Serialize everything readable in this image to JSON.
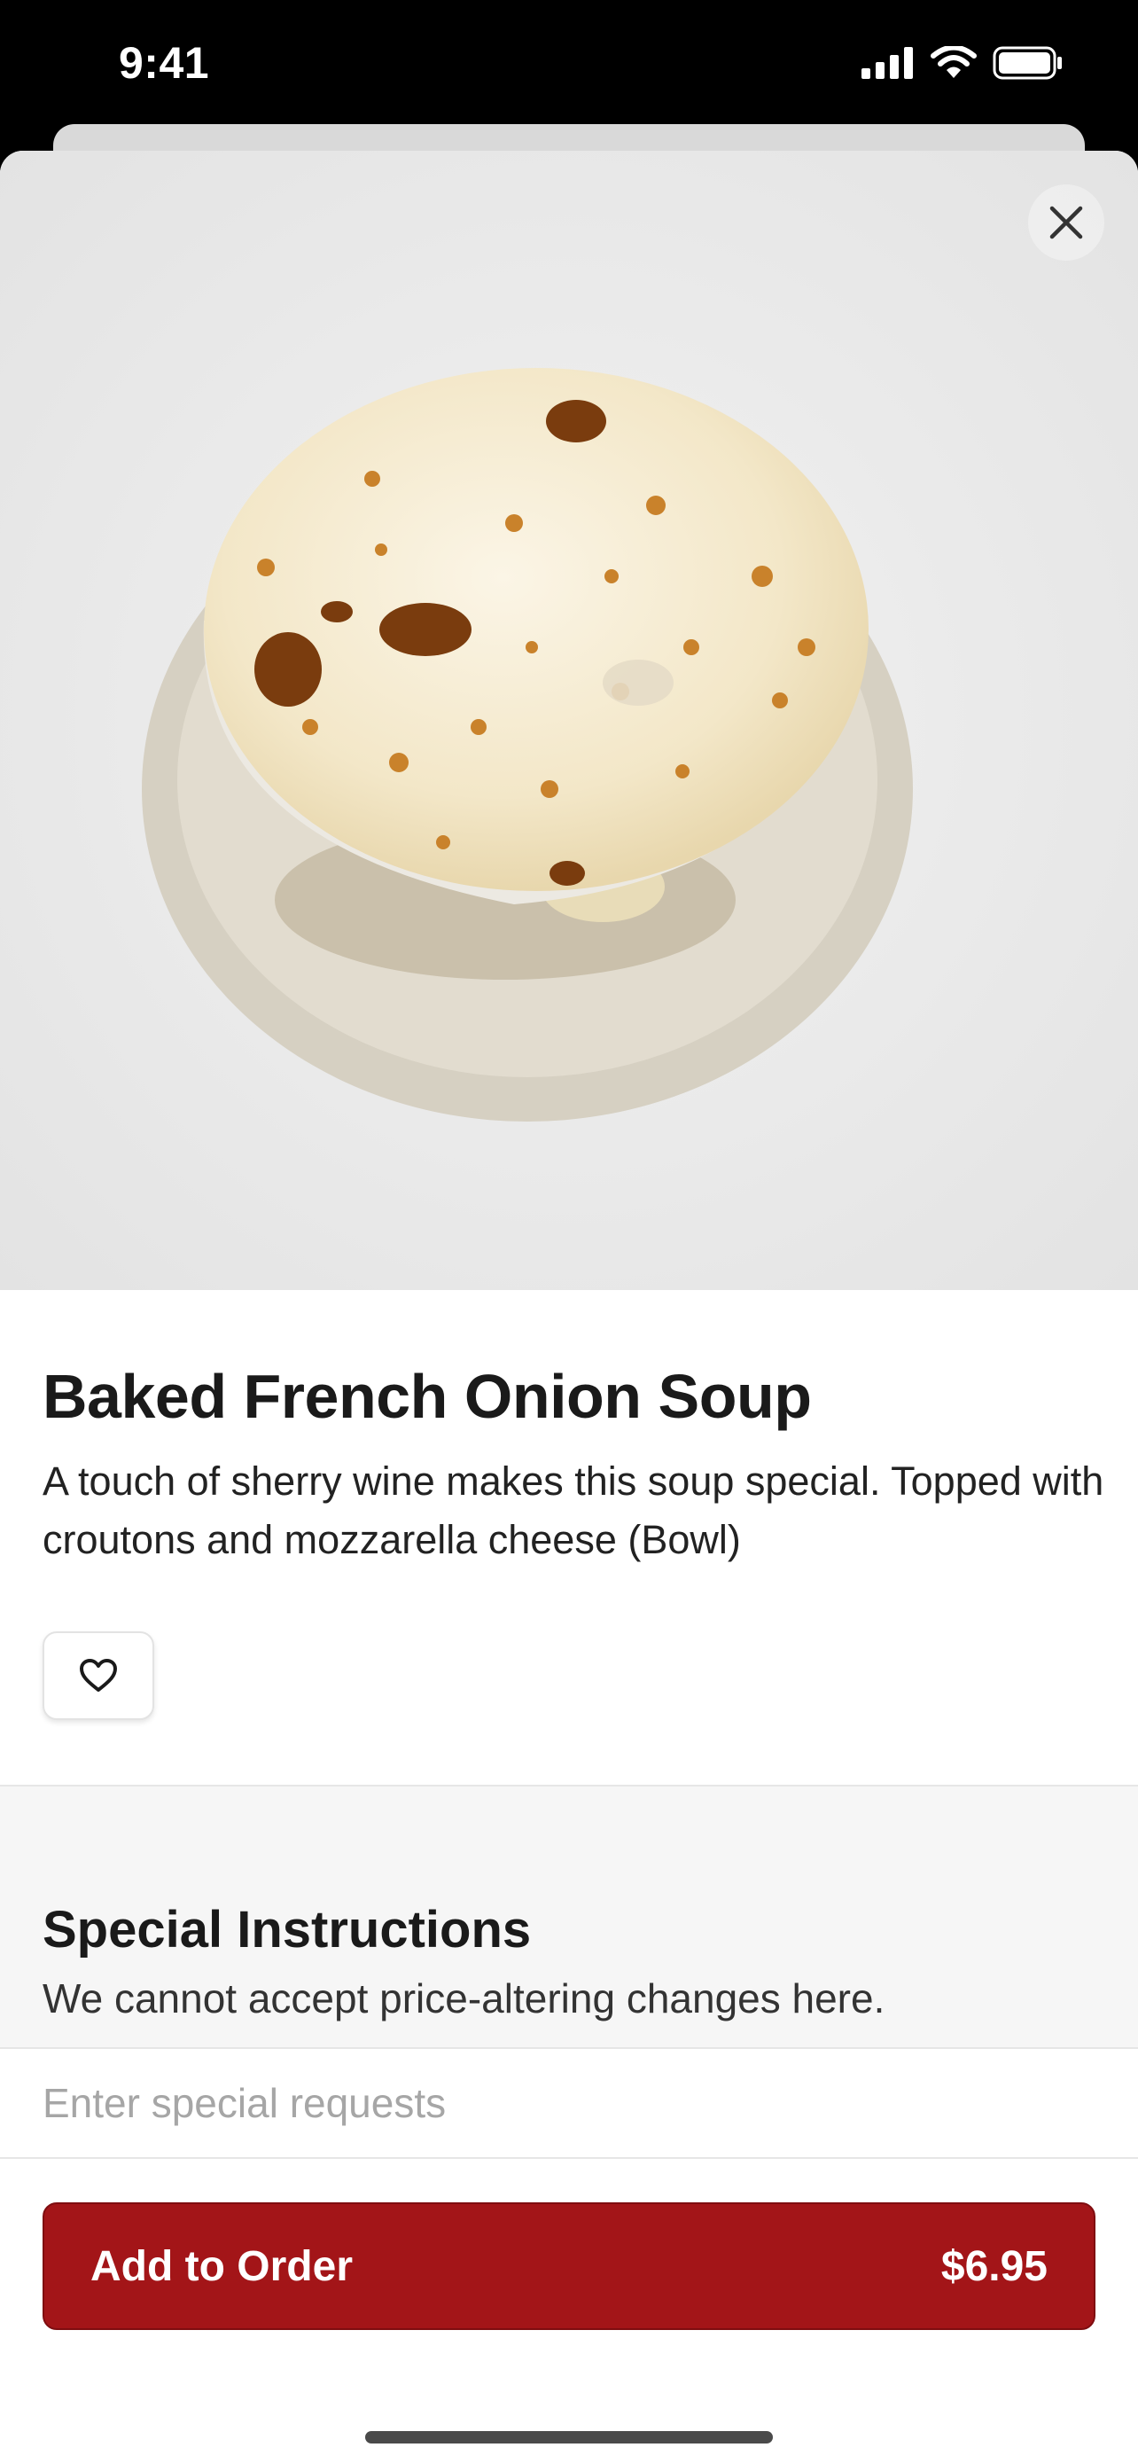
{
  "status_bar": {
    "time": "9:41",
    "icons": [
      "signal-icon",
      "wifi-icon",
      "battery-icon"
    ]
  },
  "hero": {
    "image_alt": "Baked French onion soup in a white crock on a saucer",
    "close_icon": "close-icon"
  },
  "item": {
    "title": "Baked French Onion Soup",
    "description": "A touch of sherry wine makes this soup special. Topped with croutons and mozzarella cheese (Bowl)",
    "favorite_icon": "heart-icon"
  },
  "special_instructions": {
    "title": "Special Instructions",
    "subtitle": "We cannot accept price-altering changes here.",
    "placeholder": "Enter special requests",
    "value": ""
  },
  "add_to_order": {
    "label": "Add to Order",
    "price": "$6.95"
  },
  "colors": {
    "accent": "#a31518",
    "section_bg": "#f6f6f6",
    "text": "#1a1a1a"
  }
}
